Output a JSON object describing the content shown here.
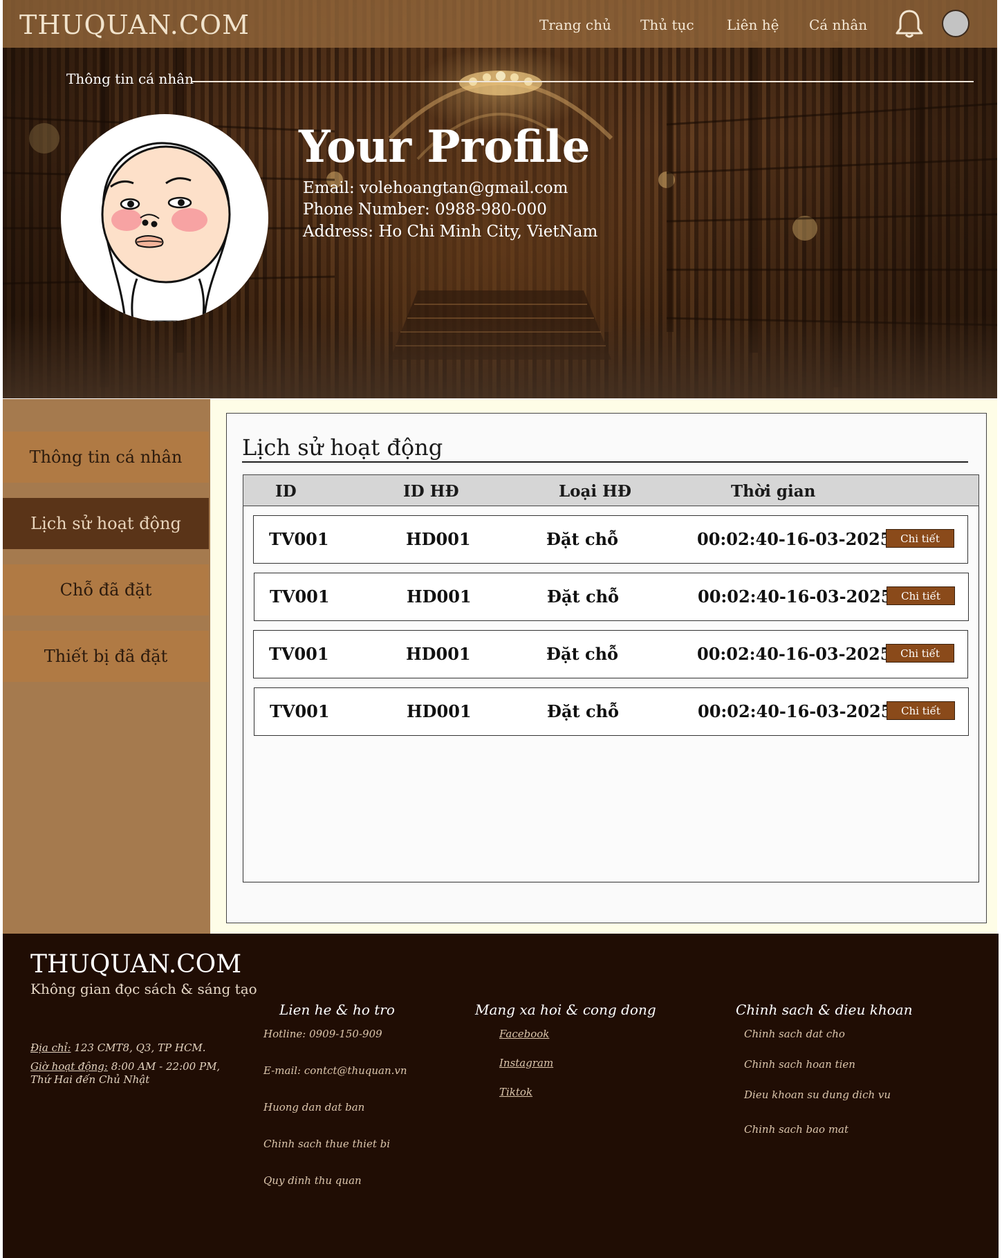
{
  "header": {
    "logo": "THUQUAN.COM",
    "nav": [
      "Trang chủ",
      "Thủ tục",
      "Liên hệ",
      "Cá nhân"
    ]
  },
  "hero": {
    "section_label": "Thông tin cá nhân",
    "title": "Your Profile",
    "email": "Email: volehoangtan@gmail.com",
    "phone": "Phone Number: 0988-980-000",
    "address": "Address: Ho Chi Minh City, VietNam"
  },
  "sidebar": {
    "items": [
      "Thông tin cá nhân",
      "Lịch sử hoạt động",
      "Chỗ đã đặt",
      "Thiết bị đã đặt"
    ],
    "active": "Lịch sử hoạt động"
  },
  "activity": {
    "title": "Lịch sử hoạt động",
    "columns": [
      "ID",
      "ID HĐ",
      "Loại HĐ",
      "Thời gian"
    ],
    "rows": [
      {
        "id": "TV001",
        "hd": "HD001",
        "type": "Đặt chỗ",
        "time": "00:02:40-16-03-2025",
        "action": "Chi tiết"
      },
      {
        "id": "TV001",
        "hd": "HD001",
        "type": "Đặt chỗ",
        "time": "00:02:40-16-03-2025",
        "action": "Chi tiết"
      },
      {
        "id": "TV001",
        "hd": "HD001",
        "type": "Đặt chỗ",
        "time": "00:02:40-16-03-2025",
        "action": "Chi tiết"
      },
      {
        "id": "TV001",
        "hd": "HD001",
        "type": "Đặt chỗ",
        "time": "00:02:40-16-03-2025",
        "action": "Chi tiết"
      }
    ]
  },
  "footer": {
    "logo": "THUQUAN.COM",
    "tagline": "Không gian đọc sách & sáng tạo",
    "address_label": "Địa chỉ:",
    "address_value": " 123 CMT8, Q3, TP HCM.",
    "hours_label": "Giờ hoạt động:",
    "hours_value": " 8:00 AM - 22:00 PM,",
    "hours_days": "Thứ Hai đến Chủ Nhật",
    "contact": {
      "heading": "Lien he & ho tro",
      "items": [
        "Hotline: 0909-150-909",
        "E-mail: contct@thuquan.vn",
        "Huong dan dat ban",
        "Chinh sach thue thiet bi",
        "Quy dinh thu quan"
      ]
    },
    "social": {
      "heading": "Mang xa hoi  & cong dong",
      "items": [
        "Facebook",
        "Instagram",
        "Tiktok"
      ]
    },
    "policy": {
      "heading": "Chinh sach & dieu khoan",
      "items": [
        "Chinh sach dat cho",
        "Chinh sach hoan tien",
        "Dieu khoan su dung dich vu",
        "Chinh sach bao mat"
      ]
    }
  }
}
